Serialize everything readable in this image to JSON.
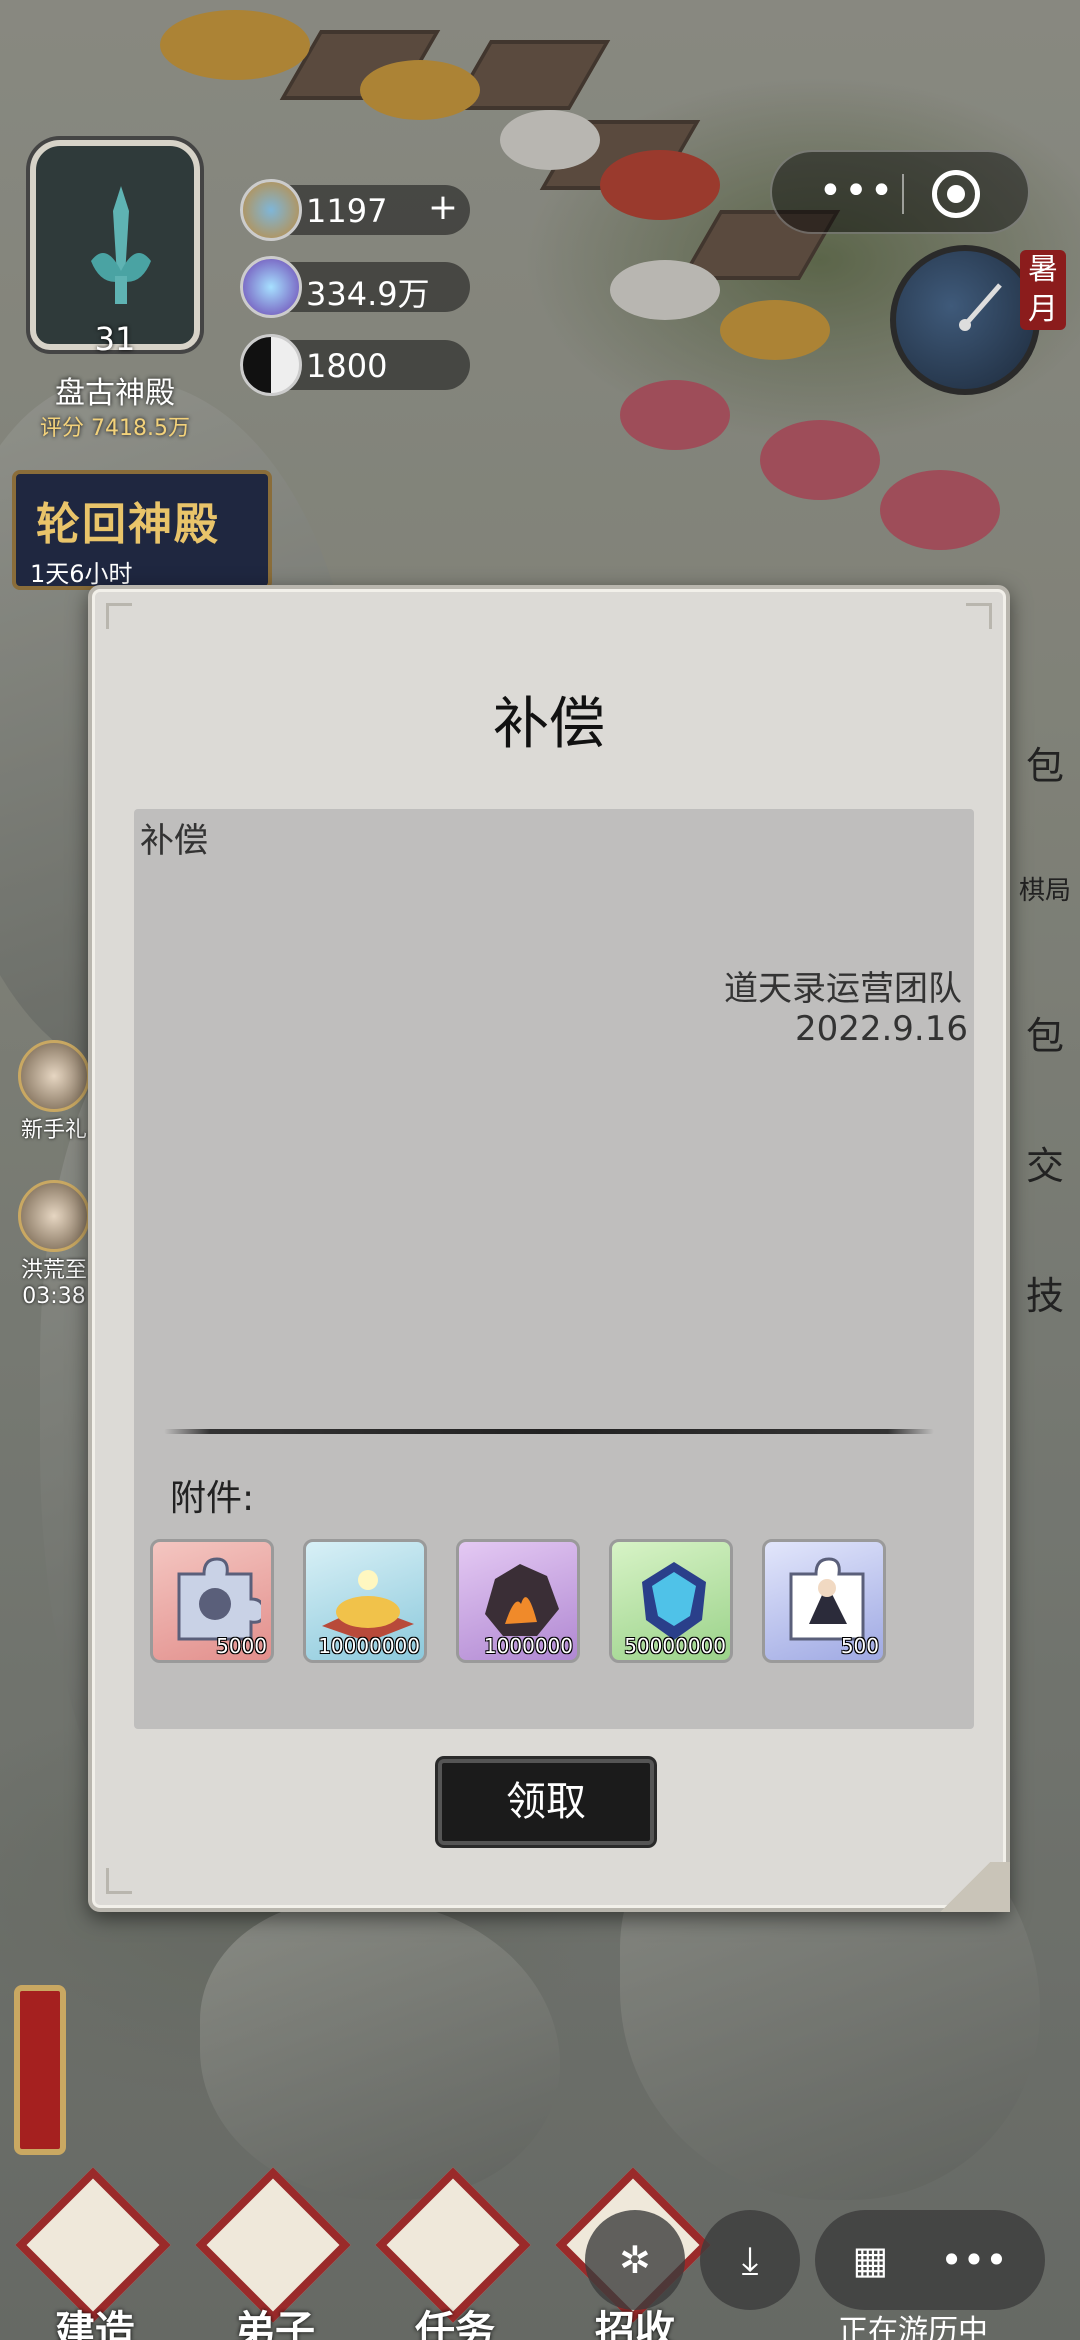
{
  "hud": {
    "temple": {
      "level": "31",
      "name": "盘古神殿",
      "score": "评分 7418.5万"
    },
    "resources": [
      {
        "icon": "spirit-stone-icon",
        "value": "1197",
        "has_plus": true,
        "plus_label": "+"
      },
      {
        "icon": "crystal-icon",
        "value": "334.9万"
      },
      {
        "icon": "yin-yang-icon",
        "value": "1800"
      }
    ],
    "event": {
      "title": "轮回神殿",
      "timer": "1天6小时"
    },
    "season": "暑月"
  },
  "side_left": [
    {
      "label": "新手礼"
    },
    {
      "label": "洪荒至",
      "timer": "03:38"
    }
  ],
  "side_right": [
    "包",
    "棋局",
    "包",
    "交",
    "技"
  ],
  "dialog": {
    "title": "补偿",
    "mail": {
      "subject": "补偿",
      "sender": "道天录运营团队",
      "date": "2022.9.16"
    },
    "attachments_label": "附件:",
    "attachments": [
      {
        "icon": "puzzle-fragment-icon",
        "qty": "5000",
        "bg": "#e9a9a6"
      },
      {
        "icon": "gold-sand-icon",
        "qty": "10000000",
        "bg": "#a9d9e6"
      },
      {
        "icon": "fire-ore-icon",
        "qty": "1000000",
        "bg": "#c9a6e0"
      },
      {
        "icon": "blue-crystal-icon",
        "qty": "50000000",
        "bg": "#b6e3a8"
      },
      {
        "icon": "character-fragment-icon",
        "qty": "500",
        "bg": "#c2c9ee"
      }
    ],
    "claim_label": "领取"
  },
  "bottom_tabs": [
    {
      "label": "建造"
    },
    {
      "label": "弟子"
    },
    {
      "label": "任务"
    },
    {
      "label": "招收"
    }
  ],
  "system": {
    "more_label": "•••",
    "grid_label": "▦",
    "dots_label": "•••",
    "playing_text": "正在游历中"
  },
  "colors": {
    "accent_red": "#9a2a2a",
    "gold": "#e9c46a",
    "dialog_bg": "#dcdad6",
    "panel_bg": "#bfbebd"
  }
}
